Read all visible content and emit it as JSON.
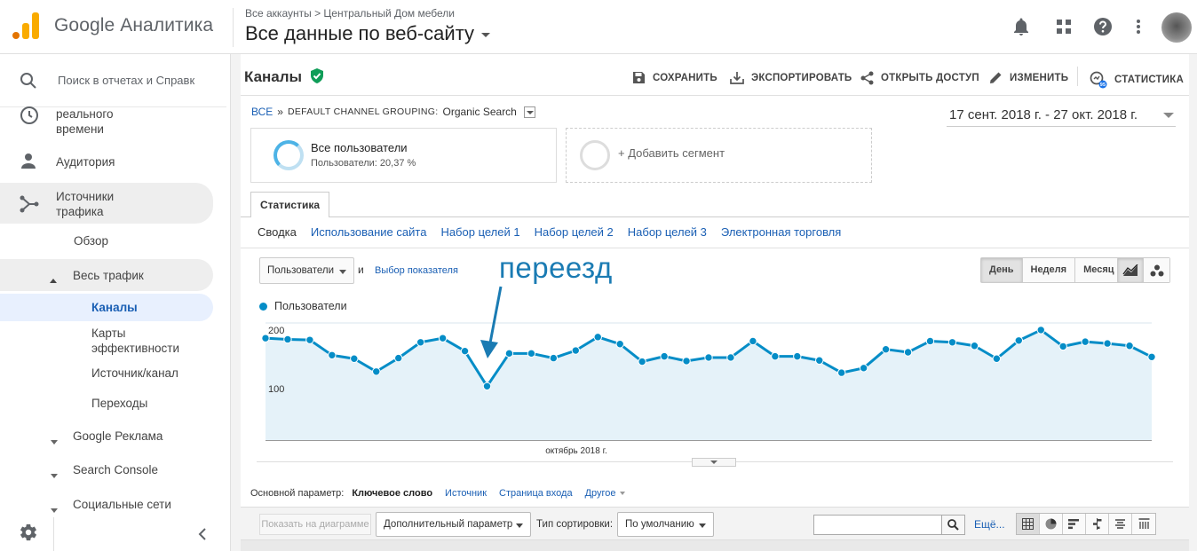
{
  "header": {
    "brand": "Google Аналитика",
    "breadcrumb": "Все аккаунты > Центральный Дом мебели",
    "property": "Все данные по веб-сайту",
    "colors": {
      "logo_orange": "#f9ab00",
      "logo_dark": "#e37400"
    }
  },
  "sidebar": {
    "search_placeholder": "Поиск в отчетах и Справк",
    "realtime": "реального времени",
    "audience": "Аудитория",
    "acquisition": "Источники трафика",
    "overview": "Обзор",
    "all_traffic": "Весь трафик",
    "channels": "Каналы",
    "treemaps": "Карты эффективности",
    "source_medium": "Источник/канал",
    "referrals": "Переходы",
    "google_ads": "Google Реклама",
    "search_console": "Search Console",
    "social": "Социальные сети"
  },
  "main": {
    "title": "Каналы",
    "actions": {
      "save": "СОХРАНИТЬ",
      "export": "ЭКСПОРТИРОВАТЬ",
      "share": "ОТКРЫТЬ ДОСТУП",
      "edit": "ИЗМЕНИТЬ",
      "insights": "СТАТИСТИКА"
    },
    "bc_all": "ВСЕ",
    "bc_sep": "»",
    "bc_grouping": "DEFAULT CHANNEL GROUPING:",
    "bc_value": "Organic Search",
    "date_range": "17 сент. 2018 г. - 27 окт. 2018 г.",
    "segment1_title": "Все пользователи",
    "segment1_sub": "Пользователи: 20,37 %",
    "segment2": "+ Добавить сегмент",
    "tab": "Статистика",
    "subtabs": [
      "Сводка",
      "Использование сайта",
      "Набор целей 1",
      "Набор целей 2",
      "Набор целей 3",
      "Электронная торговля"
    ],
    "metric": "Пользователи",
    "and": "и",
    "pick_metric": "Выбор показателя",
    "annotation": "переезд",
    "granularity": {
      "day": "День",
      "week": "Неделя",
      "month": "Месяц"
    },
    "primary_dim_label": "Основной параметр:",
    "primary_dim_current": "Ключевое слово",
    "primary_dim_source": "Источник",
    "primary_dim_landing": "Страница входа",
    "primary_dim_other": "Другое",
    "plot_rows": "Показать на диаграмме",
    "secondary_dim": "Дополнительный параметр",
    "sort_label": "Тип сортировки:",
    "sort_value": "По умолчанию",
    "more": "Ещё..."
  },
  "chart_data": {
    "type": "area",
    "legend": "Пользователи",
    "xlabel": "октябрь 2018 г.",
    "ytick_labels": [
      "200",
      "100"
    ],
    "yticks": [
      200,
      100
    ],
    "ylim": [
      0,
      300
    ],
    "grid": true,
    "color": "#058dc7",
    "fill": "#e5f2f9",
    "series": [
      {
        "name": "Пользователи",
        "values": [
          174,
          172,
          171,
          145,
          139,
          117,
          140,
          167,
          174,
          152,
          92,
          148,
          148,
          140,
          153,
          176,
          164,
          134,
          143,
          135,
          141,
          141,
          169,
          143,
          143,
          136,
          115,
          123,
          155,
          150,
          169,
          167,
          161,
          139,
          170,
          188,
          160,
          168,
          165,
          161,
          142
        ]
      }
    ]
  }
}
